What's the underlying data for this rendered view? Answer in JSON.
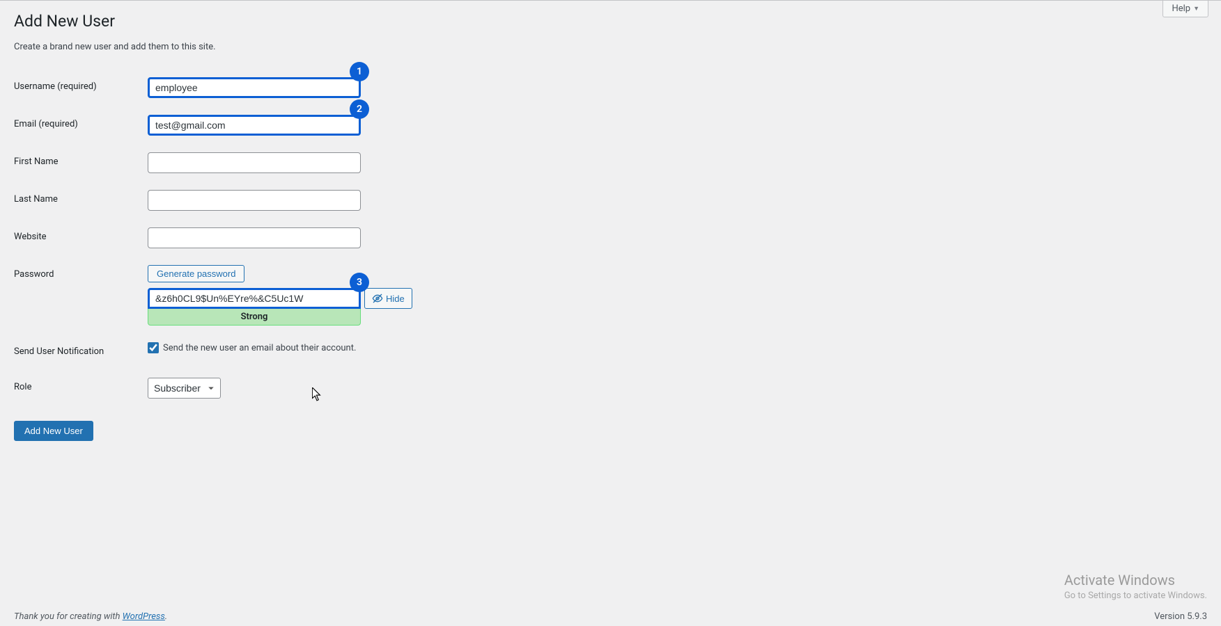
{
  "header": {
    "help_label": "Help"
  },
  "page": {
    "title": "Add New User",
    "description": "Create a brand new user and add them to this site."
  },
  "form": {
    "username": {
      "label": "Username",
      "required": "(required)",
      "value": "employee",
      "badge": "1"
    },
    "email": {
      "label": "Email",
      "required": "(required)",
      "value": "test@gmail.com",
      "badge": "2"
    },
    "first_name": {
      "label": "First Name",
      "value": ""
    },
    "last_name": {
      "label": "Last Name",
      "value": ""
    },
    "website": {
      "label": "Website",
      "value": ""
    },
    "password": {
      "label": "Password",
      "generate_label": "Generate password",
      "value": "&z6h0CL9$Un%EYre%&C5Uc1W",
      "badge": "3",
      "hide_label": "Hide",
      "strength": "Strong"
    },
    "notification": {
      "label": "Send User Notification",
      "checkbox_label": "Send the new user an email about their account.",
      "checked": true
    },
    "role": {
      "label": "Role",
      "selected": "Subscriber"
    },
    "submit_label": "Add New User"
  },
  "footer": {
    "thanks_prefix": "Thank you for creating with ",
    "link_text": "WordPress",
    "suffix": ".",
    "version": "Version 5.9.3"
  },
  "watermark": {
    "title": "Activate Windows",
    "subtitle": "Go to Settings to activate Windows."
  }
}
